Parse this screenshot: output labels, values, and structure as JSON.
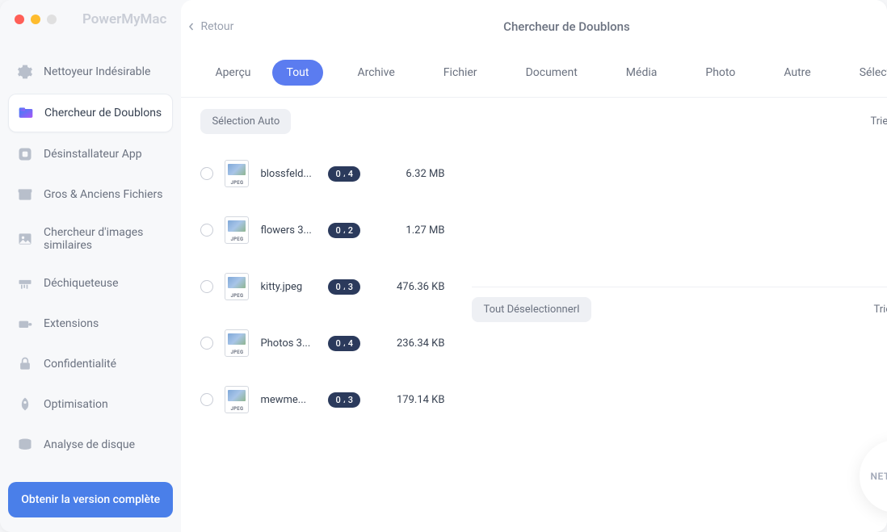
{
  "app_name": "PowerMyMac",
  "back_label": "Retour",
  "page_title": "Chercheur de Doublons",
  "help_glyph": "?",
  "sidebar": {
    "items": [
      {
        "label": "Nettoyeur Indésirable"
      },
      {
        "label": "Chercheur de Doublons"
      },
      {
        "label": "Désinstallateur App"
      },
      {
        "label": "Gros & Anciens Fichiers"
      },
      {
        "label": "Chercheur d'images similaires"
      },
      {
        "label": "Déchiqueteuse"
      },
      {
        "label": "Extensions"
      },
      {
        "label": "Confidentialité"
      },
      {
        "label": "Optimisation"
      },
      {
        "label": "Analyse de disque"
      }
    ],
    "cta": "Obtenir la version complète"
  },
  "tabs": [
    "Aperçu",
    "Tout",
    "Archive",
    "Fichier",
    "Document",
    "Média",
    "Photo",
    "Autre",
    "Sélectionné"
  ],
  "controls": {
    "auto_select": "Sélection Auto",
    "sort_by": "Trier Par"
  },
  "detail": {
    "deselect_all": "Tout DéselectionnerI",
    "sort_by": "Trier Par"
  },
  "clean_label": "NETTOYER",
  "files": [
    {
      "name": "blossfeld...",
      "badge": "0 ، 4",
      "size": "6.32 MB",
      "ext": "JPEG"
    },
    {
      "name": "flowers 3...",
      "badge": "0 ، 2",
      "size": "1.27 MB",
      "ext": "JPEG"
    },
    {
      "name": "kitty.jpeg",
      "badge": "0 ، 3",
      "size": "476.36 KB",
      "ext": "JPEG"
    },
    {
      "name": "Photos 3...",
      "badge": "0 ، 4",
      "size": "236.34 KB",
      "ext": "JPEG"
    },
    {
      "name": "mewme...",
      "badge": "0 ، 3",
      "size": "179.14 KB",
      "ext": "JPEG"
    }
  ]
}
